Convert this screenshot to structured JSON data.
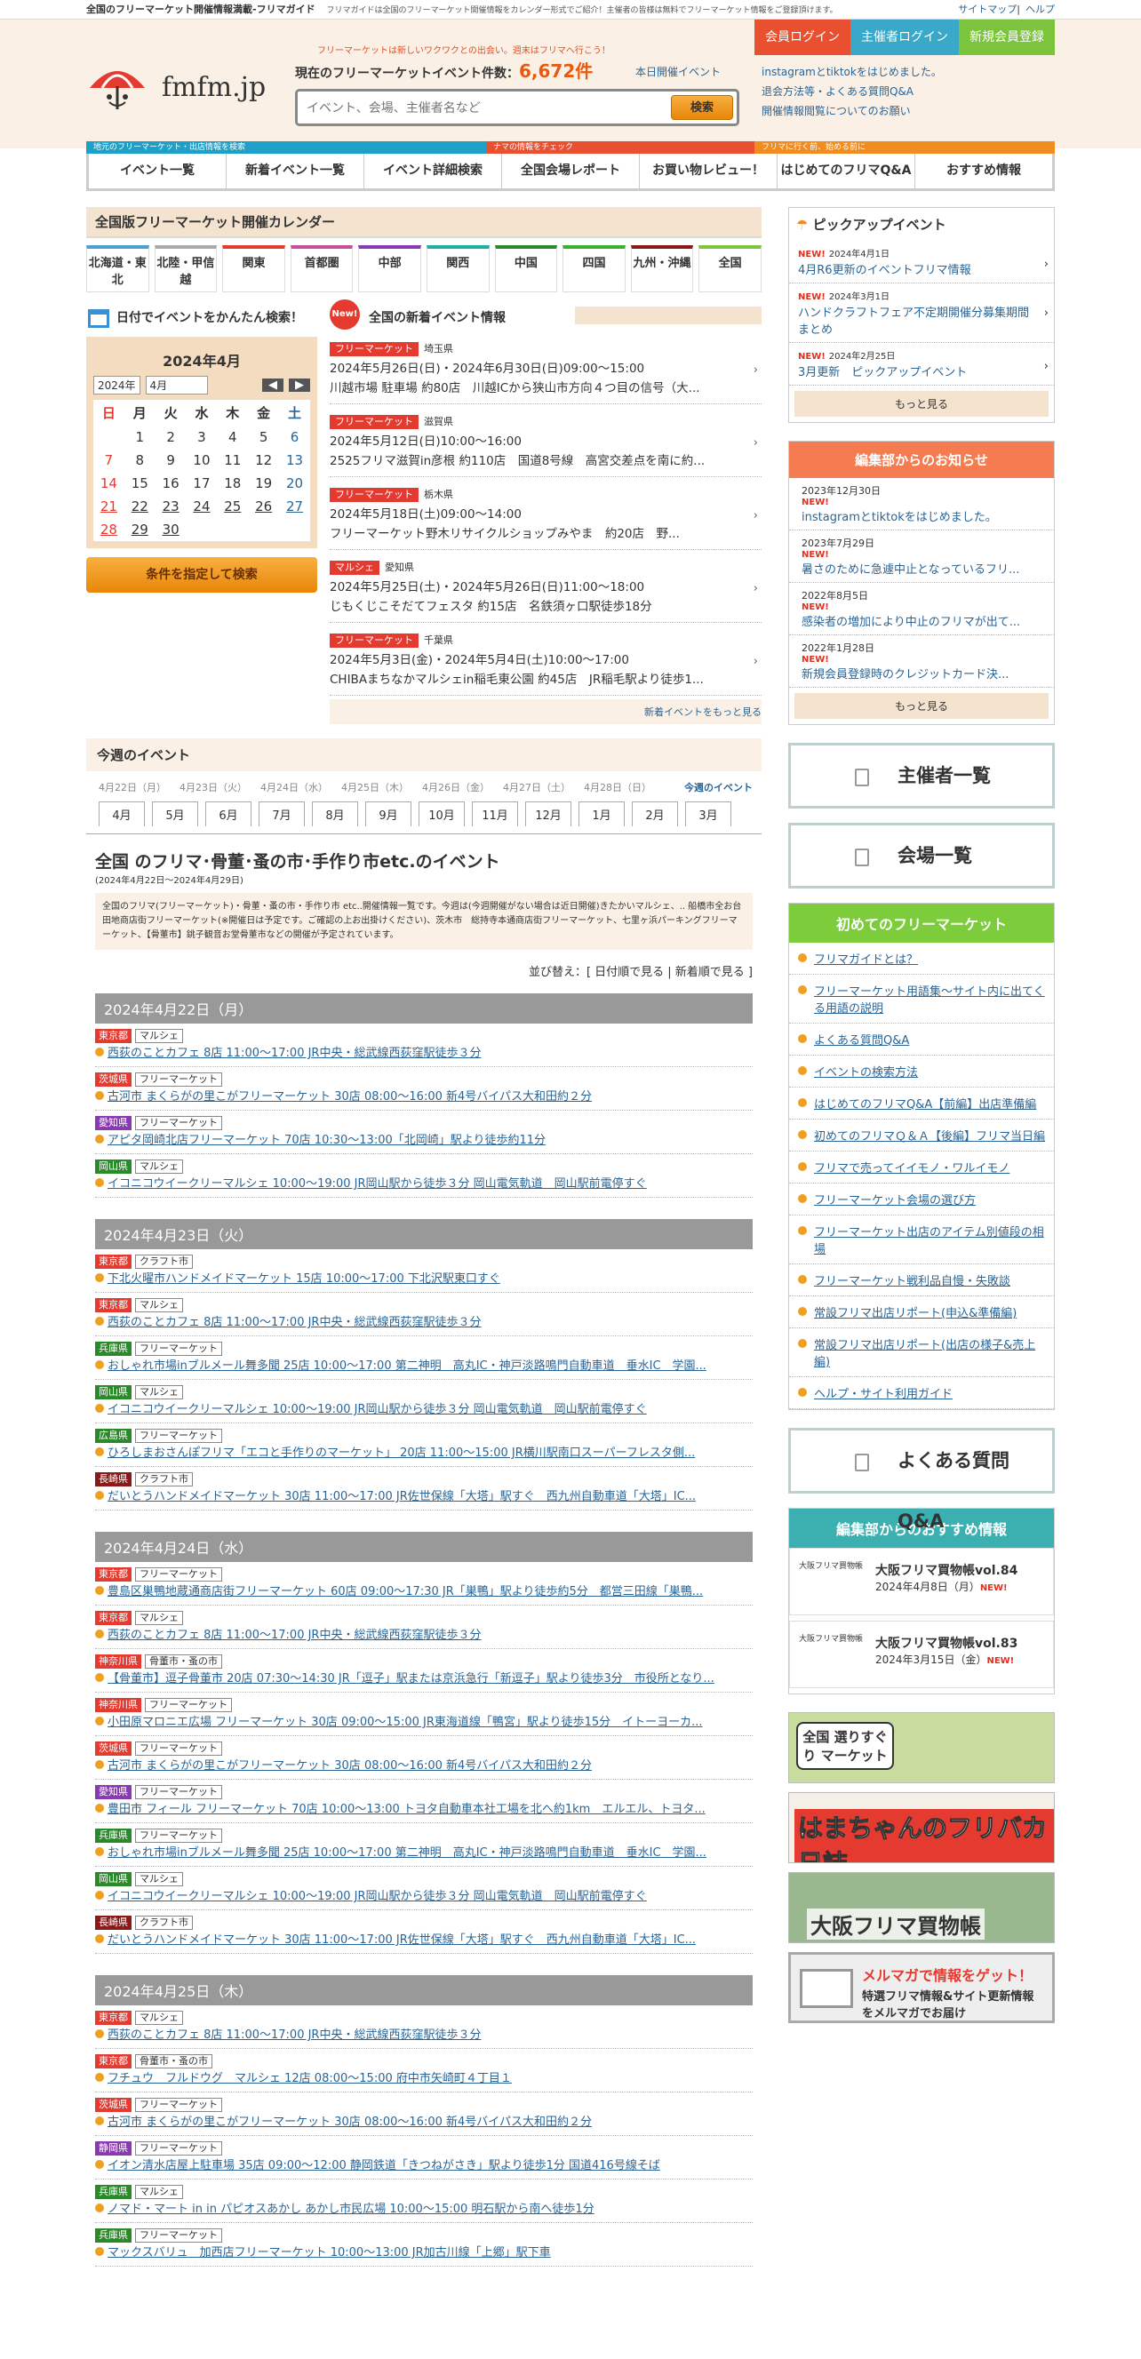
{
  "topbar": {
    "title": "全国のフリーマーケット開催情報満載-フリマガイド",
    "desc": "フリマガイドは全国のフリーマーケット開催情報をカレンダー形式でご紹介！主催者の皆様は無料でフリーマーケット情報をご登録頂けます。",
    "sitemap": "サイトマップ",
    "help": "ヘルプ"
  },
  "header": {
    "logo": "fmfm.jp",
    "tagline": "フリーマーケットは新しいワクワクとの出会い。週末はフリマへ行こう！",
    "count_label": "現在のフリーマーケットイベント件数：",
    "count": "6,672件",
    "today": "本日開催イベント",
    "search_placeholder": "イベント、会場、主催者名など",
    "search_btn": "検索",
    "notices": [
      "instagramとtiktokをはじめました。",
      "退会方法等・よくある質問Q&A",
      "開催情報閲覧についてのお願い"
    ],
    "member_login": "会員ログイン",
    "org_login": "主催者ログイン",
    "register": "新規会員登録"
  },
  "nav": {
    "labels": [
      "地元のフリーマーケット・出店情報を検索",
      "ナマの情報をチェック",
      "フリマに行く前、始める前に"
    ],
    "items": [
      "イベント一覧",
      "新着イベント一覧",
      "イベント詳細検索",
      "全国会場レポート",
      "お買い物レビュー！",
      "はじめてのフリマQ&A",
      "おすすめ情報"
    ]
  },
  "calendar": {
    "heading": "全国版フリーマーケット開催カレンダー",
    "regions": [
      "北海道・東北",
      "北陸・甲信越",
      "関東",
      "首都圏",
      "中部",
      "関西",
      "中国",
      "四国",
      "九州・沖縄",
      "全国"
    ],
    "date_search": "日付でイベントをかんたん検索！",
    "month_title": "2024年4月",
    "year_sel": "2024年",
    "month_sel": "4月",
    "weekdays": [
      "日",
      "月",
      "火",
      "水",
      "木",
      "金",
      "土"
    ],
    "weeks": [
      [
        "",
        "1",
        "2",
        "3",
        "4",
        "5",
        "6"
      ],
      [
        "7",
        "8",
        "9",
        "10",
        "11",
        "12",
        "13"
      ],
      [
        "14",
        "15",
        "16",
        "17",
        "18",
        "19",
        "20"
      ],
      [
        "21",
        "22",
        "23",
        "24",
        "25",
        "26",
        "27"
      ],
      [
        "28",
        "29",
        "30",
        "",
        "",
        "",
        ""
      ]
    ],
    "search_btn": "条件を指定して検索"
  },
  "newinfo": {
    "title": "全国の新着イベント情報",
    "events": [
      {
        "tag": "フリーマーケット",
        "pref": "埼玉県",
        "date": "2024年5月26日(日)・2024年6月30日(日)09:00～15:00",
        "desc": "川越市場 駐車場 約80店　川越ICから狭山市方向４つ目の信号（大..."
      },
      {
        "tag": "フリーマーケット",
        "pref": "滋賀県",
        "date": "2024年5月12日(日)10:00～16:00",
        "desc": "2525フリマ滋賀in彦根 約110店　国道8号線　高宮交差点を南に約..."
      },
      {
        "tag": "フリーマーケット",
        "pref": "栃木県",
        "date": "2024年5月18日(土)09:00～14:00",
        "desc": "フリーマーケット野木リサイクルショップみやま　約20店　野..."
      },
      {
        "tag": "マルシェ",
        "pref": "愛知県",
        "date": "2024年5月25日(土)・2024年5月26日(日)11:00～18:00",
        "desc": "じもくじこそだてフェスタ 約15店　名鉄須ヶ口駅徒歩18分"
      },
      {
        "tag": "フリーマーケット",
        "pref": "千葉県",
        "date": "2024年5月3日(金)・2024年5月4日(土)10:00～17:00",
        "desc": "CHIBAまちなかマルシェin稲毛東公園 約45店　JR稲毛駅より徒歩1..."
      }
    ],
    "more": "新着イベントをもっと見る"
  },
  "week": {
    "title": "今週のイベント",
    "dates": [
      "4月22日（月）",
      "4月23日（火）",
      "4月24日（水）",
      "4月25日（木）",
      "4月26日（金）",
      "4月27日（土）",
      "4月28日（日）"
    ],
    "link": "今週のイベント",
    "months": [
      "4月",
      "5月",
      "6月",
      "7月",
      "8月",
      "9月",
      "10月",
      "11月",
      "12月",
      "1月",
      "2月",
      "3月"
    ]
  },
  "page": {
    "title": "全国 のフリマ･骨董･蚤の市･手作り市etc.のイベント",
    "sub": "(2024年4月22日～2024年4月29日)",
    "desc": "全国のフリマ(フリーマーケット)・骨董・蚤の市・手作り市 etc..開催情報一覧です。今週は(今週開催がない場合は近日開催)きたかいマルシェ、.. 船橋市全お台田地商店街フリーマーケット(※開催日は予定です。ご確認の上お出掛けください)、茨木市　総持寺本通商店街フリーマーケット、七里ヶ浜パーキングフリーマーケット、【骨董市】銚子観音お堂骨董市などの開催が予定されています。",
    "sort": "並び替え：[ 日付順で見る | 新着順で見る ]"
  },
  "days": [
    {
      "label": "2024年4月22日（月）",
      "items": [
        {
          "pref": "東京都",
          "pc": "#e53a2f",
          "cat": "マルシェ",
          "text": "西荻のことカフェ 8店 11:00～17:00 JR中央・総武線西荻窪駅徒歩３分"
        },
        {
          "pref": "茨城県",
          "pc": "#e53a2f",
          "cat": "フリーマーケット",
          "text": "古河市 まくらがの里こがフリーマーケット 30店 08:00～16:00 新4号バイパス大和田約２分"
        },
        {
          "pref": "愛知県",
          "pc": "#8a3ab0",
          "cat": "フリーマーケット",
          "text": "アピタ岡崎北店フリーマーケット 70店 10:30～13:00「北岡崎」駅より徒歩約11分"
        },
        {
          "pref": "岡山県",
          "pc": "#2a8a2a",
          "cat": "マルシェ",
          "text": "イコニコウイークリーマルシェ 10:00～19:00 JR岡山駅から徒歩３分 岡山電気軌道　岡山駅前電停すぐ"
        }
      ]
    },
    {
      "label": "2024年4月23日（火）",
      "items": [
        {
          "pref": "東京都",
          "pc": "#e53a2f",
          "cat": "クラフト市",
          "text": "下北火曜市ハンドメイドマーケット 15店 10:00～17:00 下北沢駅東口すぐ"
        },
        {
          "pref": "東京都",
          "pc": "#e53a2f",
          "cat": "マルシェ",
          "text": "西荻のことカフェ 8店 11:00～17:00 JR中央・総武線西荻窪駅徒歩３分"
        },
        {
          "pref": "兵庫県",
          "pc": "#2a8a2a",
          "cat": "フリーマーケット",
          "text": "おしゃれ市場inブルメール舞多聞 25店 10:00～17:00 第二神明　高丸IC・神戸淡路鳴門自動車道　垂水IC　学園..."
        },
        {
          "pref": "岡山県",
          "pc": "#2a8a2a",
          "cat": "マルシェ",
          "text": "イコニコウイークリーマルシェ 10:00～19:00 JR岡山駅から徒歩３分 岡山電気軌道　岡山駅前電停すぐ"
        },
        {
          "pref": "広島県",
          "pc": "#2a8a2a",
          "cat": "フリーマーケット",
          "text": "ひろしまおさんぽフリマ「エコと手作りのマーケット」 20店 11:00～15:00 JR横川駅南口スーパーフレスタ側..."
        },
        {
          "pref": "長崎県",
          "pc": "#8a1a1a",
          "cat": "クラフト市",
          "text": "だいとうハンドメイドマーケット 30店 11:00～17:00 JR佐世保線「大塔」駅すぐ　西九州自動車道「大塔」IC..."
        }
      ]
    },
    {
      "label": "2024年4月24日（水）",
      "items": [
        {
          "pref": "東京都",
          "pc": "#e53a2f",
          "cat": "フリーマーケット",
          "text": "豊島区巣鴨地蔵通商店街フリーマーケット 60店 09:00～17:30 JR「巣鴨」駅より徒歩約5分　都営三田線「巣鴨..."
        },
        {
          "pref": "東京都",
          "pc": "#e53a2f",
          "cat": "マルシェ",
          "text": "西荻のことカフェ 8店 11:00～17:00 JR中央・総武線西荻窪駅徒歩３分"
        },
        {
          "pref": "神奈川県",
          "pc": "#e53a2f",
          "cat": "骨董市・蚤の市",
          "text": "【骨董市】逗子骨董市 20店 07:30～14:30 JR「逗子」駅または京浜急行「新逗子」駅より徒歩3分　市役所となり..."
        },
        {
          "pref": "神奈川県",
          "pc": "#e53a2f",
          "cat": "フリーマーケット",
          "text": "小田原マロニエ広場 フリーマーケット 30店 09:00～15:00 JR東海道線「鴨宮」駅より徒歩15分　イトーヨーカ..."
        },
        {
          "pref": "茨城県",
          "pc": "#e53a2f",
          "cat": "フリーマーケット",
          "text": "古河市 まくらがの里こがフリーマーケット 30店 08:00～16:00 新4号バイパス大和田約２分"
        },
        {
          "pref": "愛知県",
          "pc": "#8a3ab0",
          "cat": "フリーマーケット",
          "text": "豊田市 フィール フリーマーケット 70店 10:00～13:00 トヨタ自動車本社工場を北へ約1km　エルエル、トヨタ..."
        },
        {
          "pref": "兵庫県",
          "pc": "#2a8a2a",
          "cat": "フリーマーケット",
          "text": "おしゃれ市場inブルメール舞多聞 25店 10:00～17:00 第二神明　高丸IC・神戸淡路鳴門自動車道　垂水IC　学園..."
        },
        {
          "pref": "岡山県",
          "pc": "#2a8a2a",
          "cat": "マルシェ",
          "text": "イコニコウイークリーマルシェ 10:00～19:00 JR岡山駅から徒歩３分 岡山電気軌道　岡山駅前電停すぐ"
        },
        {
          "pref": "長崎県",
          "pc": "#8a1a1a",
          "cat": "クラフト市",
          "text": "だいとうハンドメイドマーケット 30店 11:00～17:00 JR佐世保線「大塔」駅すぐ　西九州自動車道「大塔」IC..."
        }
      ]
    },
    {
      "label": "2024年4月25日（木）",
      "items": [
        {
          "pref": "東京都",
          "pc": "#e53a2f",
          "cat": "マルシェ",
          "text": "西荻のことカフェ 8店 11:00～17:00 JR中央・総武線西荻窪駅徒歩３分"
        },
        {
          "pref": "東京都",
          "pc": "#e53a2f",
          "cat": "骨董市・蚤の市",
          "text": "フチュウ　フルドウグ　マルシェ 12店 08:00～15:00 府中市矢崎町４丁目１"
        },
        {
          "pref": "茨城県",
          "pc": "#e53a2f",
          "cat": "フリーマーケット",
          "text": "古河市 まくらがの里こがフリーマーケット 30店 08:00～16:00 新4号バイパス大和田約２分"
        },
        {
          "pref": "静岡県",
          "pc": "#8a3ab0",
          "cat": "フリーマーケット",
          "text": "イオン清水店屋上駐車場 35店 09:00～12:00 静岡鉄道「きつねがさき」駅より徒歩1分 国道416号線そば"
        },
        {
          "pref": "兵庫県",
          "pc": "#2a8a2a",
          "cat": "マルシェ",
          "text": "ノマド・マート in in パピオスあかし あかし市民広場 10:00～15:00 明石駅から南へ徒歩1分"
        },
        {
          "pref": "兵庫県",
          "pc": "#2a8a2a",
          "cat": "フリーマーケット",
          "text": "マックスバリュ　加西店フリーマーケット 10:00～13:00 JR加古川線「上郷」駅下車"
        }
      ]
    }
  ],
  "pickup": {
    "title": "ピックアップイベント",
    "items": [
      {
        "date": "2024年4月1日",
        "text": "4月R6更新のイベントフリマ情報"
      },
      {
        "date": "2024年3月1日",
        "text": "ハンドクラフトフェア不定期開催分募集期間まとめ"
      },
      {
        "date": "2024年2月25日",
        "text": "3月更新　ピックアップイベント"
      }
    ],
    "more": "もっと見る",
    "new": "NEW!"
  },
  "news": {
    "title": "編集部からのお知らせ",
    "items": [
      {
        "date": "2023年12月30日",
        "text": "instagramとtiktokをはじめました。"
      },
      {
        "date": "2023年7月29日",
        "text": "暑さのために急遽中止となっているフリ..."
      },
      {
        "date": "2022年8月5日",
        "text": "感染者の増加により中止のフリマが出て..."
      },
      {
        "date": "2022年1月28日",
        "text": "新規会員登録時のクレジットカード決..."
      }
    ],
    "more": "もっと見る"
  },
  "bigbtns": [
    "主催者一覧",
    "会場一覧"
  ],
  "beginner": {
    "title": "初めてのフリーマーケット",
    "items": [
      "フリマガイドとは？",
      "フリーマーケット用語集～サイト内に出てくる用語の説明",
      "よくある質問Q&A",
      "イベントの検索方法",
      "はじめてのフリマQ&A【前編】出店準備編",
      "初めてのフリマＱ＆Ａ【後編】フリマ当日編",
      "フリマで売ってイイモノ・ワルイモノ",
      "フリーマーケット会場の選び方",
      "フリーマーケット出店のアイテム別値段の相場",
      "フリーマーケット戦利品自慢・失敗談",
      "常設フリマ出店リポート(申込&準備編)",
      "常設フリマ出店リポート(出店の様子&売上編)",
      "ヘルプ・サイト利用ガイド"
    ]
  },
  "faq": "よくある質問 Q&A",
  "recommend": {
    "title": "編集部からのおすすめ情報",
    "items": [
      {
        "logo": "大阪フリマ買物帳",
        "title": "大阪フリマ買物帳vol.84",
        "date": "2024年4月8日（月）",
        "new": "NEW!"
      },
      {
        "logo": "大阪フリマ買物帳",
        "title": "大阪フリマ買物帳vol.83",
        "date": "2024年3月15日（金）",
        "new": "NEW!"
      }
    ]
  },
  "banners": [
    "全国 選りすぐり マーケット",
    "はまちゃんのフリバカ日誌",
    "大阪フリマ買物帳",
    "メルマガで情報をゲット！",
    "特選フリマ情報&サイト更新情報をメルマガでお届け"
  ]
}
